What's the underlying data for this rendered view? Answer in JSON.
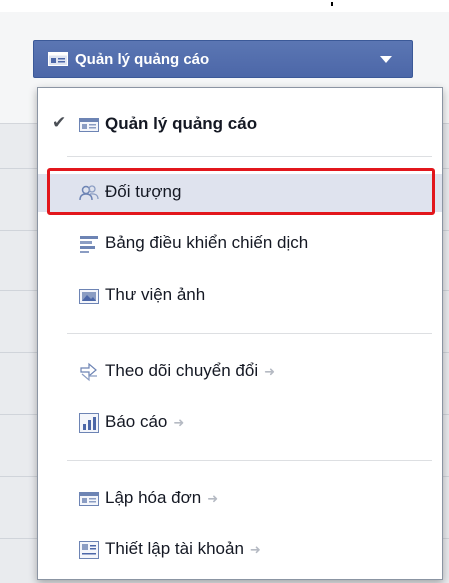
{
  "menu_button": {
    "label": "Quản lý quảng cáo",
    "icon": "ads-manager-icon"
  },
  "dropdown": {
    "items": [
      {
        "label": "Quản lý quảng cáo",
        "icon": "ads-manager-icon",
        "checked": true,
        "bold": true
      },
      {
        "label": "Đối tượng",
        "icon": "audience-icon",
        "highlighted": true
      },
      {
        "label": "Bảng điều khiển chiến dịch",
        "icon": "campaign-dashboard-icon"
      },
      {
        "label": "Thư viện ảnh",
        "icon": "image-library-icon"
      },
      {
        "label": "Theo dõi chuyển đổi",
        "icon": "conversion-tracking-icon",
        "arrow": "➜"
      },
      {
        "label": "Báo cáo",
        "icon": "reports-icon",
        "arrow": "➜"
      },
      {
        "label": "Lập hóa đơn",
        "icon": "billing-icon",
        "arrow": "➜"
      },
      {
        "label": "Thiết lập tài khoản",
        "icon": "account-settings-icon",
        "arrow": "➜"
      }
    ],
    "check_mark": "✔"
  },
  "colors": {
    "button_bg": "#4c67a8",
    "highlight_border": "#e2161c",
    "highlight_bg": "#dfe3ee"
  }
}
